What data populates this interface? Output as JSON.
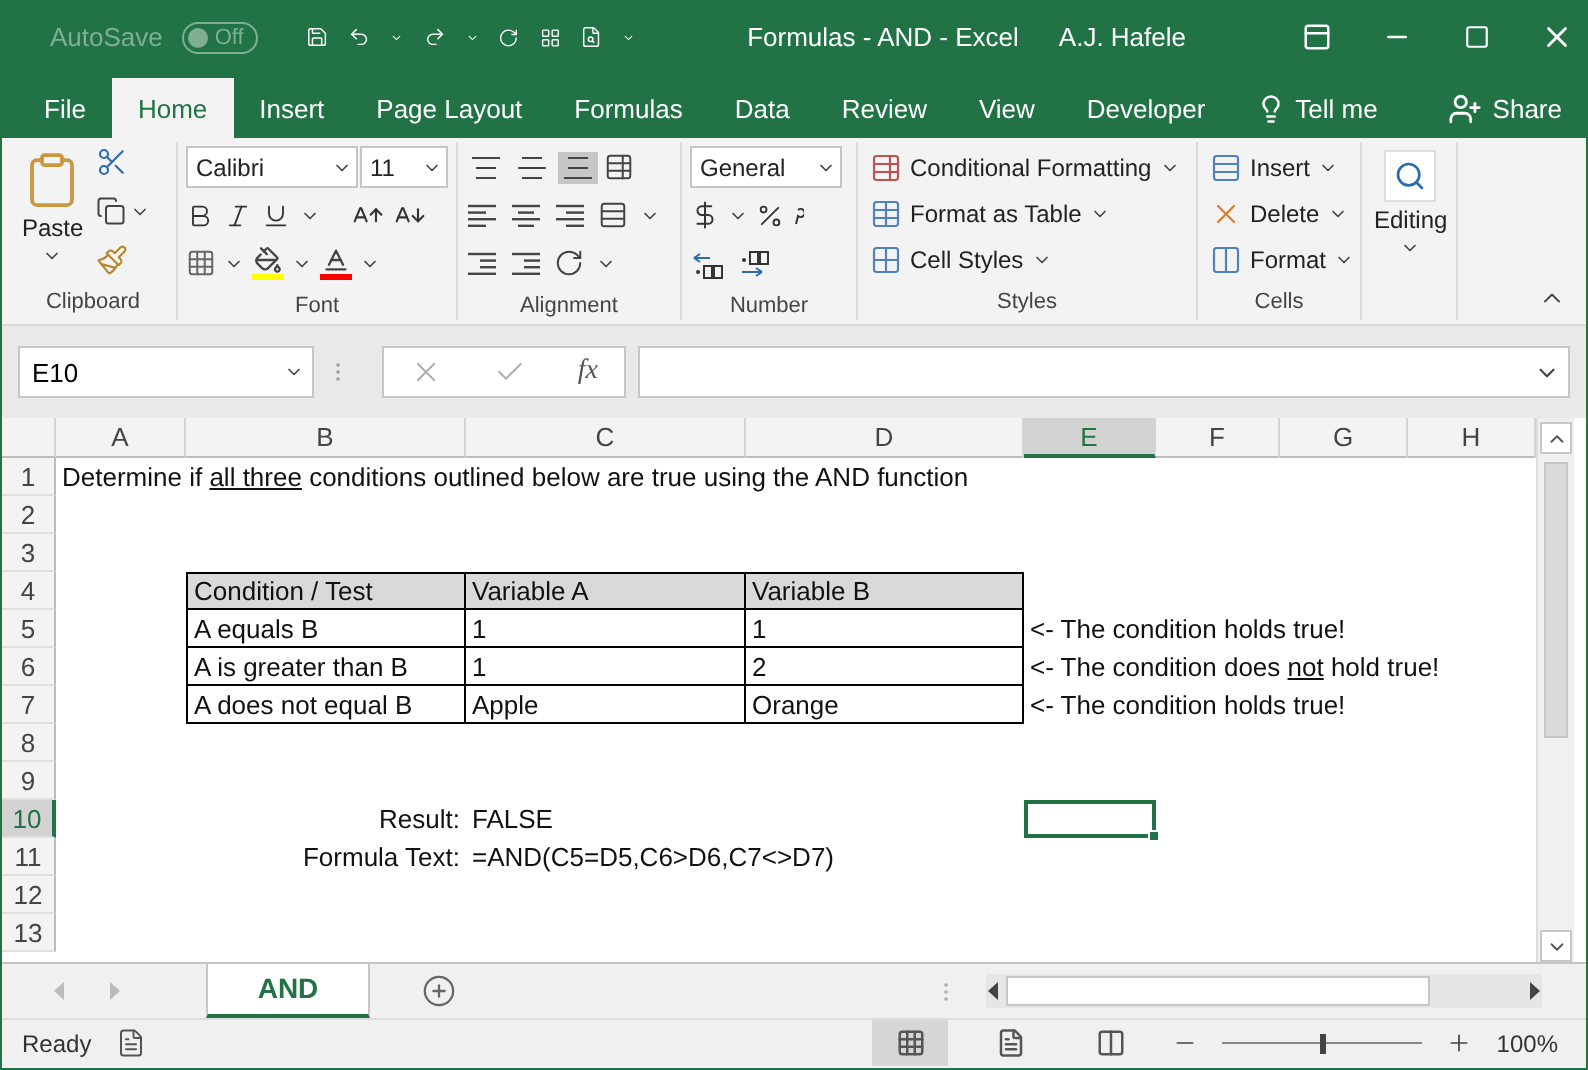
{
  "title_bar": {
    "autosave_label": "AutoSave",
    "autosave_toggle": {
      "label": "Off",
      "on": false
    },
    "title": "Formulas - AND  -  Excel",
    "user": "A.J. Hafele"
  },
  "ribbon_tabs": [
    {
      "label": "File",
      "selected": false
    },
    {
      "label": "Home",
      "selected": true
    },
    {
      "label": "Insert",
      "selected": false
    },
    {
      "label": "Page Layout",
      "selected": false
    },
    {
      "label": "Formulas",
      "selected": false
    },
    {
      "label": "Data",
      "selected": false
    },
    {
      "label": "Review",
      "selected": false
    },
    {
      "label": "View",
      "selected": false
    },
    {
      "label": "Developer",
      "selected": false
    }
  ],
  "tell_me": "Tell me",
  "share": "Share",
  "ribbon": {
    "clipboard": {
      "paste": "Paste",
      "label": "Clipboard"
    },
    "font": {
      "font_name": "Calibri",
      "font_size": "11",
      "label": "Font"
    },
    "alignment": {
      "vertical_buttons": [
        {
          "selected": false
        },
        {
          "selected": false
        },
        {
          "selected": true
        }
      ],
      "label": "Alignment"
    },
    "number": {
      "format": "General",
      "label": "Number"
    },
    "styles": {
      "buttons": [
        "Conditional Formatting",
        "Format as Table",
        "Cell Styles"
      ],
      "label": "Styles"
    },
    "cells": {
      "buttons": [
        "Insert",
        "Delete",
        "Format"
      ],
      "label": "Cells"
    },
    "editing": {
      "label": "Editing"
    }
  },
  "formula_bar": {
    "name_box": "E10",
    "function_symbol": "fx"
  },
  "sheet": {
    "columns": [
      {
        "label": "A",
        "selected": false
      },
      {
        "label": "B",
        "selected": false
      },
      {
        "label": "C",
        "selected": false
      },
      {
        "label": "D",
        "selected": false
      },
      {
        "label": "E",
        "selected": true
      },
      {
        "label": "F",
        "selected": false
      },
      {
        "label": "G",
        "selected": false
      },
      {
        "label": "H",
        "selected": false
      }
    ],
    "rows": [
      {
        "label": "1",
        "selected": false
      },
      {
        "label": "2",
        "selected": false
      },
      {
        "label": "3",
        "selected": false
      },
      {
        "label": "4",
        "selected": false
      },
      {
        "label": "5",
        "selected": false
      },
      {
        "label": "6",
        "selected": false
      },
      {
        "label": "7",
        "selected": false
      },
      {
        "label": "8",
        "selected": false
      },
      {
        "label": "9",
        "selected": false
      },
      {
        "label": "10",
        "selected": true
      },
      {
        "label": "11",
        "selected": false
      },
      {
        "label": "12",
        "selected": false
      },
      {
        "label": "13",
        "selected": false
      }
    ],
    "intro": [
      {
        "text": "Determine if ",
        "underline": false
      },
      {
        "text": "all three",
        "underline": true
      },
      {
        "text": " conditions outlined below are true using the AND function",
        "underline": false
      }
    ],
    "table": {
      "header": [
        "Condition / Test",
        "Variable A",
        "Variable B"
      ],
      "rows": [
        {
          "cells": [
            "A equals B",
            "1",
            "1"
          ],
          "note": [
            {
              "text": "<- The condition holds true!",
              "underline": false
            }
          ]
        },
        {
          "cells": [
            "A is greater than B",
            "1",
            "2"
          ],
          "note": [
            {
              "text": "<- The condition does ",
              "underline": false
            },
            {
              "text": "not",
              "underline": true
            },
            {
              "text": " hold true!",
              "underline": false
            }
          ]
        },
        {
          "cells": [
            "A does not equal B",
            "Apple",
            "Orange"
          ],
          "note": [
            {
              "text": "<- The condition holds true!",
              "underline": false
            }
          ]
        }
      ]
    },
    "result": {
      "label": "Result:",
      "value": "FALSE"
    },
    "formula_text": {
      "label": "Formula Text:",
      "value": "=AND(C5=D5,C6>D6,C7<>D7)"
    }
  },
  "sheet_tabs": [
    {
      "label": "AND",
      "selected": true
    }
  ],
  "status_bar": {
    "status": "Ready",
    "views": [
      {
        "selected": true
      },
      {
        "selected": false
      },
      {
        "selected": false
      }
    ],
    "zoom_slider": {
      "level": 0.5
    },
    "zoom": "100%"
  }
}
